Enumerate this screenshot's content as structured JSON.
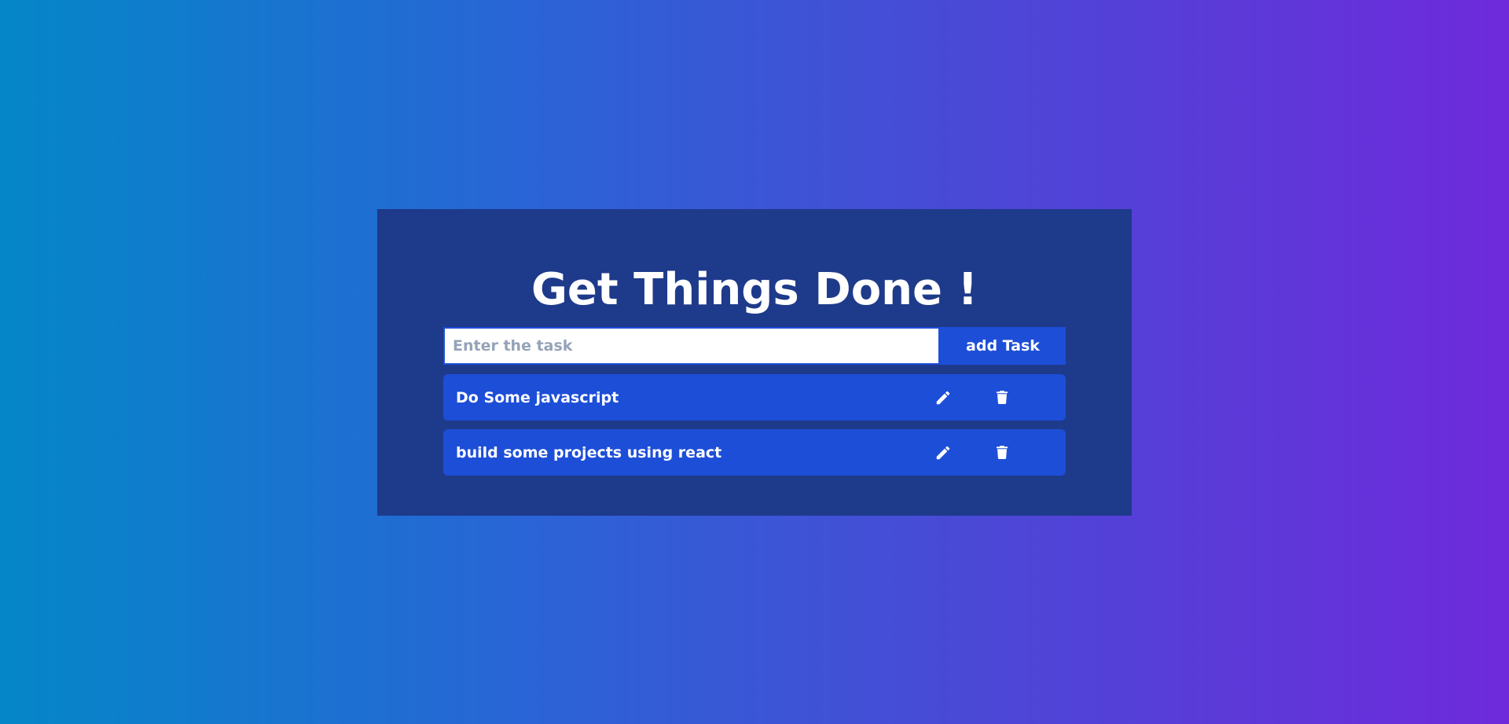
{
  "app": {
    "title": "Get Things Done !"
  },
  "form": {
    "input_value": "",
    "input_placeholder": "Enter the task",
    "add_label": "add Task"
  },
  "tasks": [
    {
      "text": "Do Some javascript",
      "edit_icon": "pencil-icon",
      "delete_icon": "trash-icon"
    },
    {
      "text": "build some projects using react",
      "edit_icon": "pencil-icon",
      "delete_icon": "trash-icon"
    }
  ],
  "colors": {
    "background_start": "#0487c8",
    "background_end": "#6e2adb",
    "panel": "#1e3a8a",
    "accent": "#1d4ed8",
    "text": "#ffffff",
    "placeholder": "#94a3b8"
  }
}
